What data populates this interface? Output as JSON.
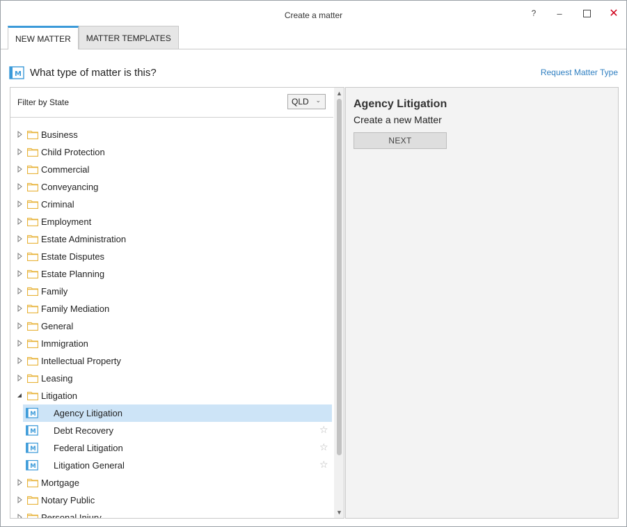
{
  "window": {
    "title": "Create a matter"
  },
  "titlebar": {
    "help": "?",
    "minimize": "–",
    "maximize": "☐",
    "close": "✕"
  },
  "tabs": [
    {
      "label": "NEW MATTER",
      "active": true
    },
    {
      "label": "MATTER TEMPLATES",
      "active": false
    }
  ],
  "heading": {
    "text": "What type of matter is this?",
    "icon": "matter-icon"
  },
  "request_link": "Request Matter Type",
  "filter": {
    "label": "Filter by State",
    "selected": "QLD"
  },
  "tree": [
    {
      "label": "Business",
      "expanded": false
    },
    {
      "label": "Child Protection",
      "expanded": false
    },
    {
      "label": "Commercial",
      "expanded": false
    },
    {
      "label": "Conveyancing",
      "expanded": false
    },
    {
      "label": "Criminal",
      "expanded": false
    },
    {
      "label": "Employment",
      "expanded": false
    },
    {
      "label": "Estate Administration",
      "expanded": false
    },
    {
      "label": "Estate Disputes",
      "expanded": false
    },
    {
      "label": "Estate Planning",
      "expanded": false
    },
    {
      "label": "Family",
      "expanded": false
    },
    {
      "label": "Family Mediation",
      "expanded": false
    },
    {
      "label": "General",
      "expanded": false
    },
    {
      "label": "Immigration",
      "expanded": false
    },
    {
      "label": "Intellectual Property",
      "expanded": false
    },
    {
      "label": "Leasing",
      "expanded": false
    },
    {
      "label": "Litigation",
      "expanded": true,
      "children": [
        {
          "label": "Agency Litigation",
          "selected": true
        },
        {
          "label": "Debt Recovery",
          "selected": false
        },
        {
          "label": "Federal Litigation",
          "selected": false
        },
        {
          "label": "Litigation General",
          "selected": false
        }
      ]
    },
    {
      "label": "Mortgage",
      "expanded": false
    },
    {
      "label": "Notary Public",
      "expanded": false
    },
    {
      "label": "Personal Injury",
      "expanded": false
    }
  ],
  "detail": {
    "title": "Agency Litigation",
    "subtitle": "Create a new Matter",
    "next_label": "NEXT"
  },
  "colors": {
    "accent": "#3b9ad9",
    "link": "#2f7fc1",
    "folder": "#e8b33a",
    "selection": "#cde4f7",
    "close": "#d0021b"
  }
}
